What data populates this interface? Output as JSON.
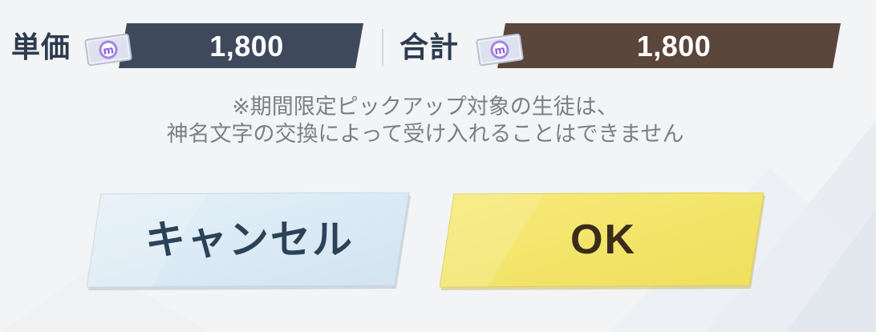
{
  "price": {
    "unit_label": "単価",
    "unit_value": "1,800",
    "total_label": "合計",
    "total_value": "1,800",
    "currency_icon": "eleph-ticket-icon"
  },
  "notice": {
    "line1": "※期間限定ピックアップ対象の生徒は、",
    "line2": "神名文字の交換によって受け入れることはできません"
  },
  "buttons": {
    "cancel_label": "キャンセル",
    "ok_label": "OK"
  },
  "colors": {
    "unit_plate": "#3e4a5c",
    "total_plate": "#5a463a",
    "cancel_button": "#d9e9f4",
    "ok_button": "#f3e46b",
    "text_dark": "#2d3b50",
    "notice_text": "#7d7f82"
  }
}
